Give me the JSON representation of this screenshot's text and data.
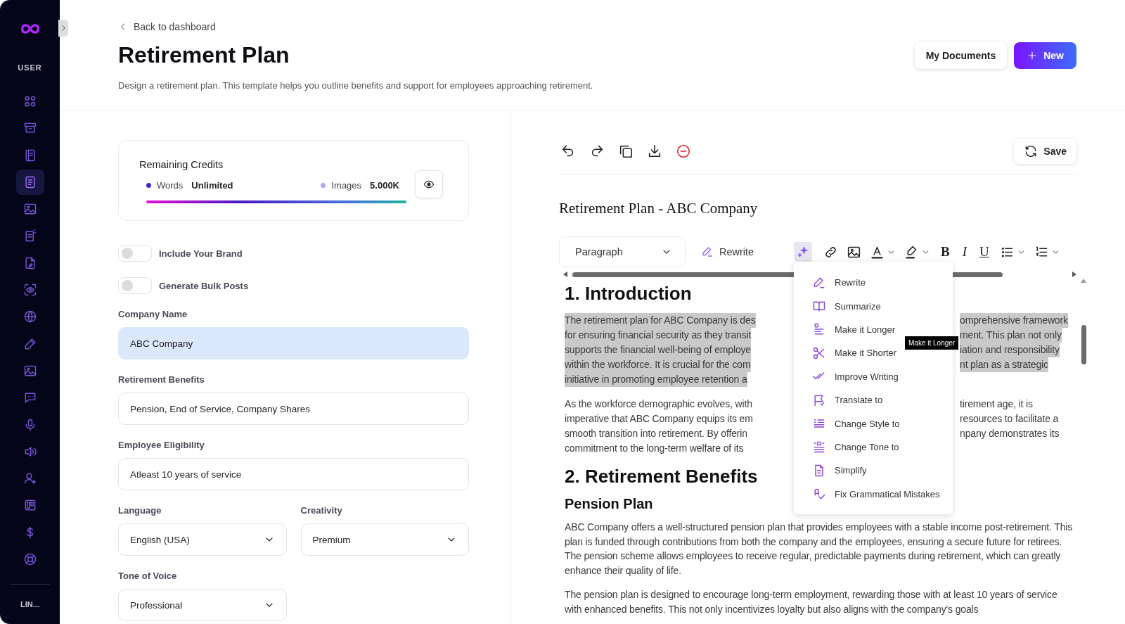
{
  "sidebar": {
    "section_label": "USER",
    "items": [
      {
        "selected": false
      },
      {
        "selected": false
      },
      {
        "selected": false
      },
      {
        "selected": true
      },
      {
        "selected": false
      },
      {
        "selected": false
      },
      {
        "selected": false
      },
      {
        "selected": false
      },
      {
        "selected": false
      },
      {
        "selected": false
      },
      {
        "selected": false
      },
      {
        "selected": false
      },
      {
        "selected": false
      },
      {
        "selected": false
      },
      {
        "selected": false
      },
      {
        "selected": false
      },
      {
        "selected": false
      },
      {
        "selected": false
      }
    ],
    "footer_label": "LIN..."
  },
  "header": {
    "back_link": "Back to dashboard",
    "title": "Retirement Plan",
    "description": "Design a retirement plan. This template helps you outline benefits and support for employees approaching retirement.",
    "buttons": [
      {
        "label": "My Documents",
        "kind": "secondary"
      },
      {
        "label": "New",
        "kind": "primary"
      }
    ]
  },
  "credits": {
    "title": "Remaining Credits",
    "items": [
      {
        "label": "Words",
        "value": "Unlimited",
        "color": "#3b2bd9"
      },
      {
        "label": "Images",
        "value": "5.000K",
        "color": "#b9a3f0"
      }
    ],
    "level": 1
  },
  "toggles": [
    {
      "label": "Include Your Brand",
      "on": false
    },
    {
      "label": "Generate Bulk Posts",
      "on": false
    }
  ],
  "form_rows": [
    {
      "fields": [
        {
          "label": "Company Name",
          "value": "ABC Company",
          "kind": "text",
          "focused": true
        }
      ]
    },
    {
      "fields": [
        {
          "label": "Retirement Benefits",
          "value": "Pension, End of Service, Company Shares",
          "kind": "text",
          "focused": false
        }
      ]
    },
    {
      "fields": [
        {
          "label": "Employee Eligibility",
          "value": "Atleast 10 years of service",
          "kind": "text",
          "focused": false
        }
      ]
    },
    {
      "fields": [
        {
          "label": "Language",
          "value": "English (USA)",
          "kind": "select",
          "focused": false
        },
        {
          "label": "Creativity",
          "value": "Premium",
          "kind": "select",
          "focused": false
        }
      ]
    },
    {
      "fields": [
        {
          "label": "Tone of Voice",
          "value": "Professional",
          "kind": "select",
          "focused": false
        }
      ]
    }
  ],
  "editor": {
    "save_button": "Save",
    "document_title": "Retirement Plan - ABC Company",
    "format_bar": {
      "block_style": "Paragraph",
      "rewrite_button": "Rewrite",
      "ai_active": true,
      "marks": [
        {
          "label": "B",
          "kind": "bold"
        },
        {
          "label": "I",
          "kind": "italic"
        },
        {
          "label": "U",
          "kind": "underline"
        }
      ]
    },
    "content": [
      {
        "kind": "h1",
        "text": "1. Introduction"
      },
      {
        "kind": "split_paragraph",
        "selected": true,
        "lines": [
          {
            "left": "The retirement plan for ABC Company is des",
            "right": "omprehensive framework"
          },
          {
            "left": "for ensuring financial security as they transit",
            "right": "ment. This plan not only"
          },
          {
            "left": "supports the financial well-being of employe",
            "right": "iation and responsibility"
          },
          {
            "left": "within the workforce. It is crucial for the com",
            "right": "nt plan as a strategic"
          },
          {
            "left": "initiative in promoting employee retention a"
          }
        ]
      },
      {
        "kind": "split_paragraph",
        "selected": false,
        "lines": [
          {
            "left": "As the workforce demographic evolves, with",
            "right": "tirement age, it is"
          },
          {
            "left": "imperative that ABC Company equips its em",
            "right": "resources to facilitate a"
          },
          {
            "left": "smooth transition into retirement. By offerin",
            "right": "npany demonstrates its"
          },
          {
            "left": "commitment to the long-term welfare of its"
          }
        ]
      },
      {
        "kind": "h1",
        "text": "2. Retirement Benefits"
      },
      {
        "kind": "h2",
        "text": "Pension Plan"
      },
      {
        "kind": "paragraph",
        "text": "ABC Company offers a well-structured pension plan that provides employees with a stable income post-retirement. This plan is funded through contributions from both the company and the employees, ensuring a secure future for retirees. The pension scheme allows employees to receive regular, predictable payments during retirement, which can greatly enhance their quality of life."
      },
      {
        "kind": "paragraph",
        "text": "The pension plan is designed to encourage long-term employment, rewarding those with at least 10 years of service with enhanced benefits. This not only incentivizes loyalty but also aligns with the company's goals"
      }
    ],
    "ai_menu": {
      "items": [
        "Rewrite",
        "Summarize",
        "Make it Longer",
        "Make it Shorter",
        "Improve Writing",
        "Translate to",
        "Change Style to",
        "Change Tone to",
        "Simplify",
        "Fix Grammatical Mistakes"
      ],
      "tooltip": "Make it Longer"
    }
  }
}
